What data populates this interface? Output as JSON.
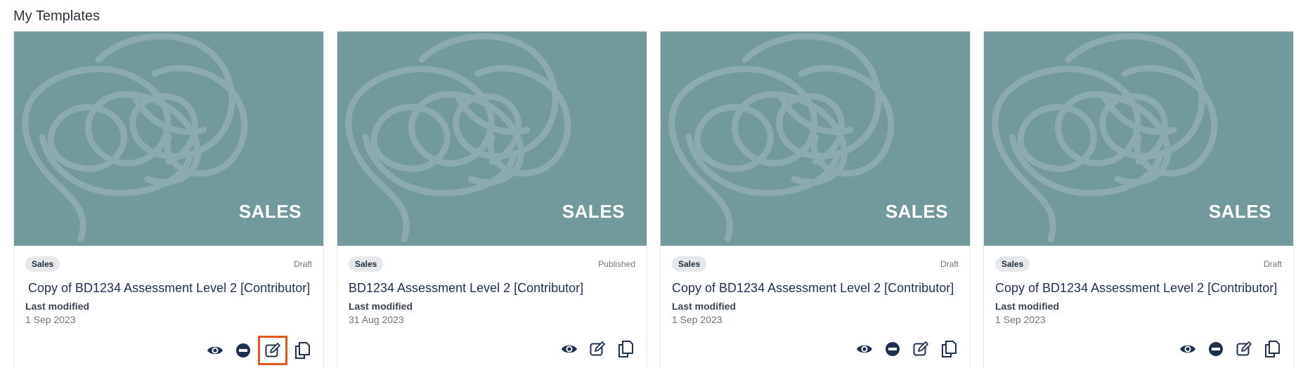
{
  "page": {
    "heading": "My Templates"
  },
  "cards": [
    {
      "banner_text": "SALES",
      "tag": "Sales",
      "status": "Draft",
      "title": "Copy of BD1234 Assessment Level 2 [Contributor]",
      "last_modified_label": "Last modified",
      "last_modified_date": "1 Sep 2023",
      "actions": [
        "eye-icon",
        "unpublish-icon",
        "edit-icon",
        "duplicate-icon"
      ],
      "highlighted_action": "edit-icon"
    },
    {
      "banner_text": "SALES",
      "tag": "Sales",
      "status": "Published",
      "title": "BD1234 Assessment Level 2 [Contributor]",
      "last_modified_label": "Last modified",
      "last_modified_date": "31 Aug 2023",
      "actions": [
        "eye-icon",
        "edit-icon",
        "duplicate-icon"
      ]
    },
    {
      "banner_text": "SALES",
      "tag": "Sales",
      "status": "Draft",
      "title": "Copy of BD1234 Assessment Level 2 [Contributor]",
      "last_modified_label": "Last modified",
      "last_modified_date": "1 Sep 2023",
      "actions": [
        "eye-icon",
        "unpublish-icon",
        "edit-icon",
        "duplicate-icon"
      ]
    },
    {
      "banner_text": "SALES",
      "tag": "Sales",
      "status": "Draft",
      "title": "Copy of BD1234 Assessment Level 2 [Contributor]",
      "last_modified_label": "Last modified",
      "last_modified_date": "1 Sep 2023",
      "actions": [
        "eye-icon",
        "unpublish-icon",
        "edit-icon",
        "duplicate-icon"
      ]
    }
  ],
  "colors": {
    "banner": "#72999c",
    "scribble": "#8eaeb3",
    "icon": "#1e3050",
    "highlight": "#e8541e"
  }
}
